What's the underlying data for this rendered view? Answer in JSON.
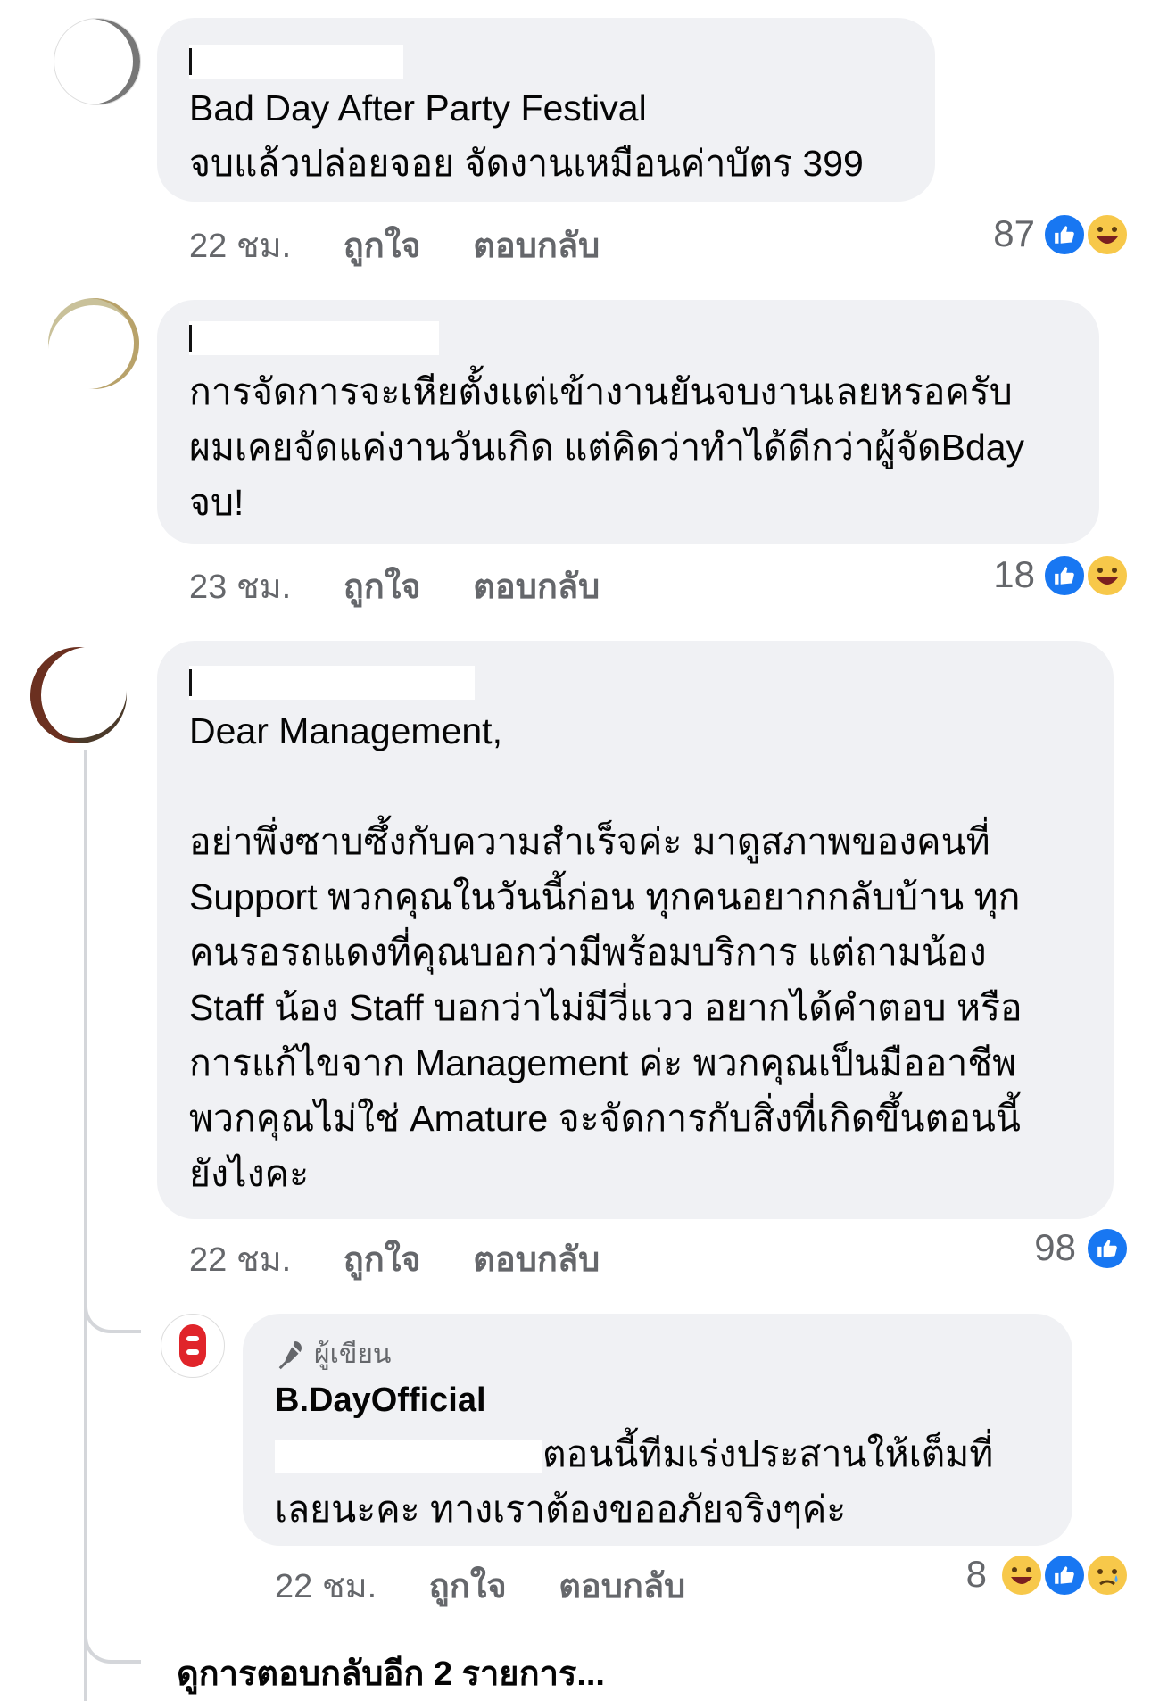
{
  "comments": [
    {
      "lines": [
        "Bad Day After Party Festival",
        "จบแล้วปล่อยจอย จัดงานเหมือนค่าบัตร 399"
      ],
      "time": "22 ชม.",
      "like": "ถูกใจ",
      "reply": "ตอบกลับ",
      "reaction_count": "87",
      "reactions": [
        "like-icon",
        "haha-icon"
      ]
    },
    {
      "lines": [
        "การจัดการจะเหียตั้งแต่เข้างานยันจบงานเลยหรอครับ",
        "ผมเคยจัดแค่งานวันเกิด แต่คิดว่าทำได้ดีกว่าผู้จัดBday",
        "จบ!"
      ],
      "time": "23 ชม.",
      "like": "ถูกใจ",
      "reply": "ตอบกลับ",
      "reaction_count": "18",
      "reactions": [
        "like-icon",
        "haha-icon"
      ]
    },
    {
      "lines": [
        "Dear Management,",
        "",
        "อย่าพึ่งซาบซึ้งกับความสำเร็จค่ะ มาดูสภาพของคนที่",
        "Support พวกคุณในวันนี้ก่อน ทุกคนอยากกลับบ้าน ทุก",
        "คนรอรถแดงที่คุณบอกว่ามีพร้อมบริการ แต่ถามน้อง",
        "Staff น้อง Staff บอกว่าไม่มีวี่แวว อยากได้คำตอบ หรือ",
        "การแก้ไขจาก Management ค่ะ พวกคุณเป็นมืออาชีพ",
        "พวกคุณไม่ใช่ Amature จะจัดการกับสิ่งที่เกิดขึ้นตอนนี้",
        "ยังไงคะ"
      ],
      "time": "22 ชม.",
      "like": "ถูกใจ",
      "reply": "ตอบกลับ",
      "reaction_count": "98",
      "reactions": [
        "like-icon"
      ]
    }
  ],
  "reply": {
    "badge": "ผู้เขียน",
    "author": "B.DayOfficial",
    "line1": "ตอนนี้ทีมเร่งประสานให้เต็มที่",
    "line2": "เลยนะคะ ทางเราต้องขออภัยจริงๆค่ะ",
    "time": "22 ชม.",
    "like": "ถูกใจ",
    "reply": "ตอบกลับ",
    "reaction_count": "8",
    "reactions": [
      "haha-icon",
      "like-icon",
      "sad-icon"
    ]
  },
  "more_replies": "ดูการตอบกลับอีก 2 รายการ...",
  "colors": {
    "like": "#1877f2",
    "bubble": "#f0f1f4",
    "meta": "#65676b"
  }
}
